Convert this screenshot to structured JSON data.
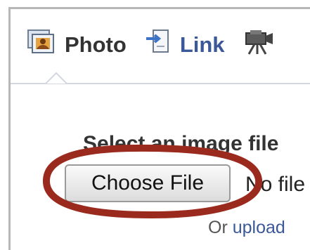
{
  "tabs": [
    {
      "label": "Photo",
      "icon": "photo-icon",
      "active": true
    },
    {
      "label": "Link",
      "icon": "link-icon",
      "active": false
    },
    {
      "label": "",
      "icon": "video-camera-icon",
      "active": false
    }
  ],
  "upload": {
    "select_label": "Select an image file",
    "choose_button": "Choose File",
    "no_file_text": "No file",
    "or_text": "Or",
    "upload_link": "upload"
  },
  "colors": {
    "link": "#3b5998",
    "annotation": "#9b2a1e"
  }
}
